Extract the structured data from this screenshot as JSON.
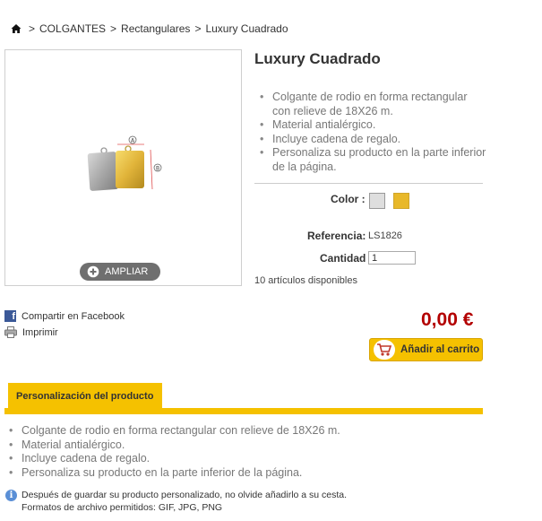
{
  "breadcrumb": {
    "items": [
      "COLGANTES",
      "Rectangulares",
      "Luxury Cuadrado"
    ],
    "separator": ">"
  },
  "product": {
    "title": "Luxury Cuadrado",
    "features": [
      "Colgante de rodio en forma rectangular con relieve de 18X26 m.",
      "Material antialérgico.",
      "Incluye cadena de regalo.",
      "Personaliza su producto en la parte inferior de la página."
    ],
    "zoom_label": "AMPLIAR",
    "color_label": "Color :",
    "colors": [
      "#dedede",
      "#e8b829"
    ],
    "reference_label": "Referencia:",
    "reference_value": "LS1826",
    "quantity_label": "Cantidad",
    "quantity_value": "1",
    "availability": "10 artículos disponibles",
    "price": "0,00 €",
    "add_to_cart": "Añadir al carrito"
  },
  "social": {
    "facebook": "Compartir en Facebook",
    "print": "Imprimir"
  },
  "customization": {
    "tab_label": "Personalización del producto",
    "features": [
      "Colgante de rodio en forma rectangular con relieve de 18X26 m.",
      "Material antialérgico.",
      "Incluye cadena de regalo.",
      "Personaliza su producto en la parte inferior de la página."
    ],
    "info_line1": "Después de guardar su producto personalizado, no olvide añadirlo a su cesta.",
    "info_line2": "Formatos de archivo permitidos: GIF, JPG, PNG"
  },
  "icons": [
    "home-icon",
    "zoom-icon",
    "facebook-icon",
    "printer-icon",
    "cart-icon",
    "info-icon"
  ]
}
